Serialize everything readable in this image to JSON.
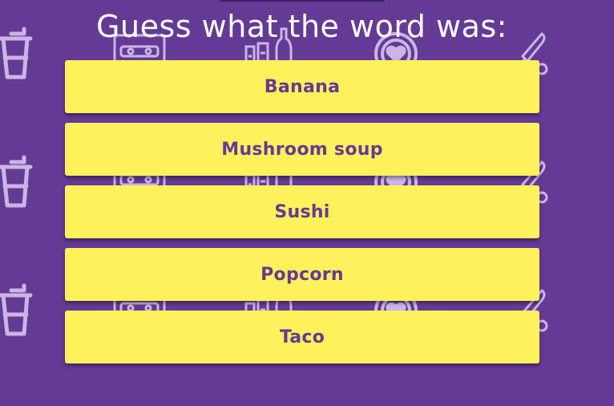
{
  "game": {
    "title": "Guess what the word was:",
    "options": [
      {
        "label": "Banana"
      },
      {
        "label": "Mushroom soup"
      },
      {
        "label": "Sushi"
      },
      {
        "label": "Popcorn"
      },
      {
        "label": "Taco"
      }
    ]
  },
  "theme": {
    "background": "#643a96",
    "button_color": "#fef15b",
    "button_text_color": "#643a96",
    "title_color": "#ffffff",
    "pattern_color": "#c9b6e4"
  },
  "background_pattern": {
    "icons": [
      "cup-icon",
      "cassette-icon",
      "bottles-icon",
      "heart-badge-icon",
      "knife-icon"
    ]
  }
}
